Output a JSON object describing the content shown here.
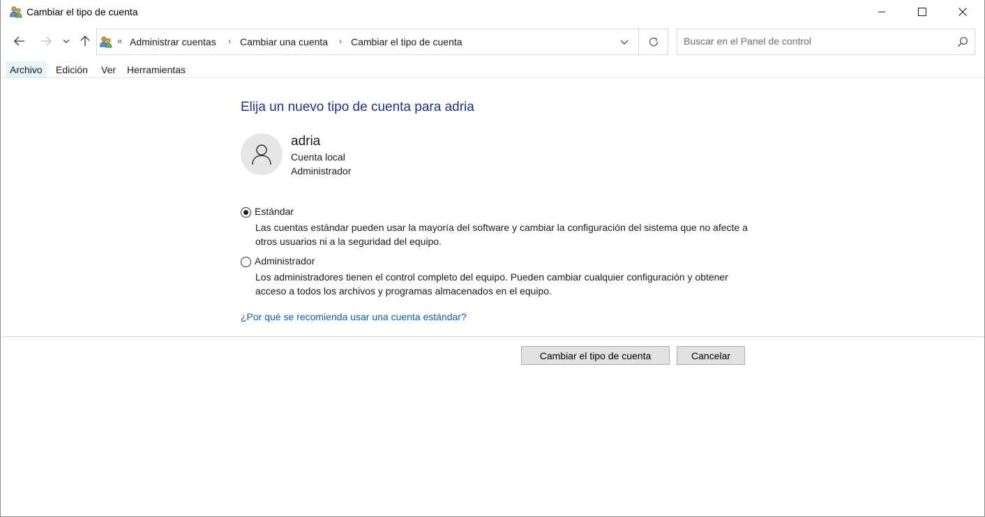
{
  "window": {
    "title": "Cambiar el tipo de cuenta",
    "app_icon": "users-icon",
    "controls": [
      "minimize-icon",
      "maximize-icon",
      "close-icon"
    ]
  },
  "address_bar": {
    "overflow_glyph": "«",
    "breadcrumbs": [
      {
        "label": "Administrar cuentas"
      },
      {
        "label": "Cambiar una cuenta"
      },
      {
        "label": "Cambiar el tipo de cuenta"
      }
    ]
  },
  "search": {
    "placeholder": "Buscar en el Panel de control"
  },
  "menu": {
    "items": [
      {
        "label": "Archivo"
      },
      {
        "label": "Edición"
      },
      {
        "label": "Ver"
      },
      {
        "label": "Herramientas"
      }
    ]
  },
  "main": {
    "heading": "Elija un nuevo tipo de cuenta para adria",
    "user": {
      "name": "adria",
      "account_kind": "Cuenta local",
      "role": "Administrador"
    },
    "options": [
      {
        "label": "Estándar",
        "description": "Las cuentas estándar pueden usar la mayoría del software y cambiar la configuración del sistema que no afecte a otros usuarios ni a la seguridad del equipo.",
        "selected": true
      },
      {
        "label": "Administrador",
        "description": "Los administradores tienen el control completo del equipo. Pueden cambiar cualquier configuración y obtener acceso a todos los archivos y programas almacenados en el equipo.",
        "selected": false
      }
    ],
    "help_link": "¿Por qué se recomienda usar una cuenta estándar?",
    "buttons": {
      "confirm": "Cambiar el tipo de cuenta",
      "cancel": "Cancelar"
    }
  },
  "colors": {
    "heading": "#1e3287",
    "link": "#0b5ea8",
    "menu_active": "#e5f3fb"
  }
}
